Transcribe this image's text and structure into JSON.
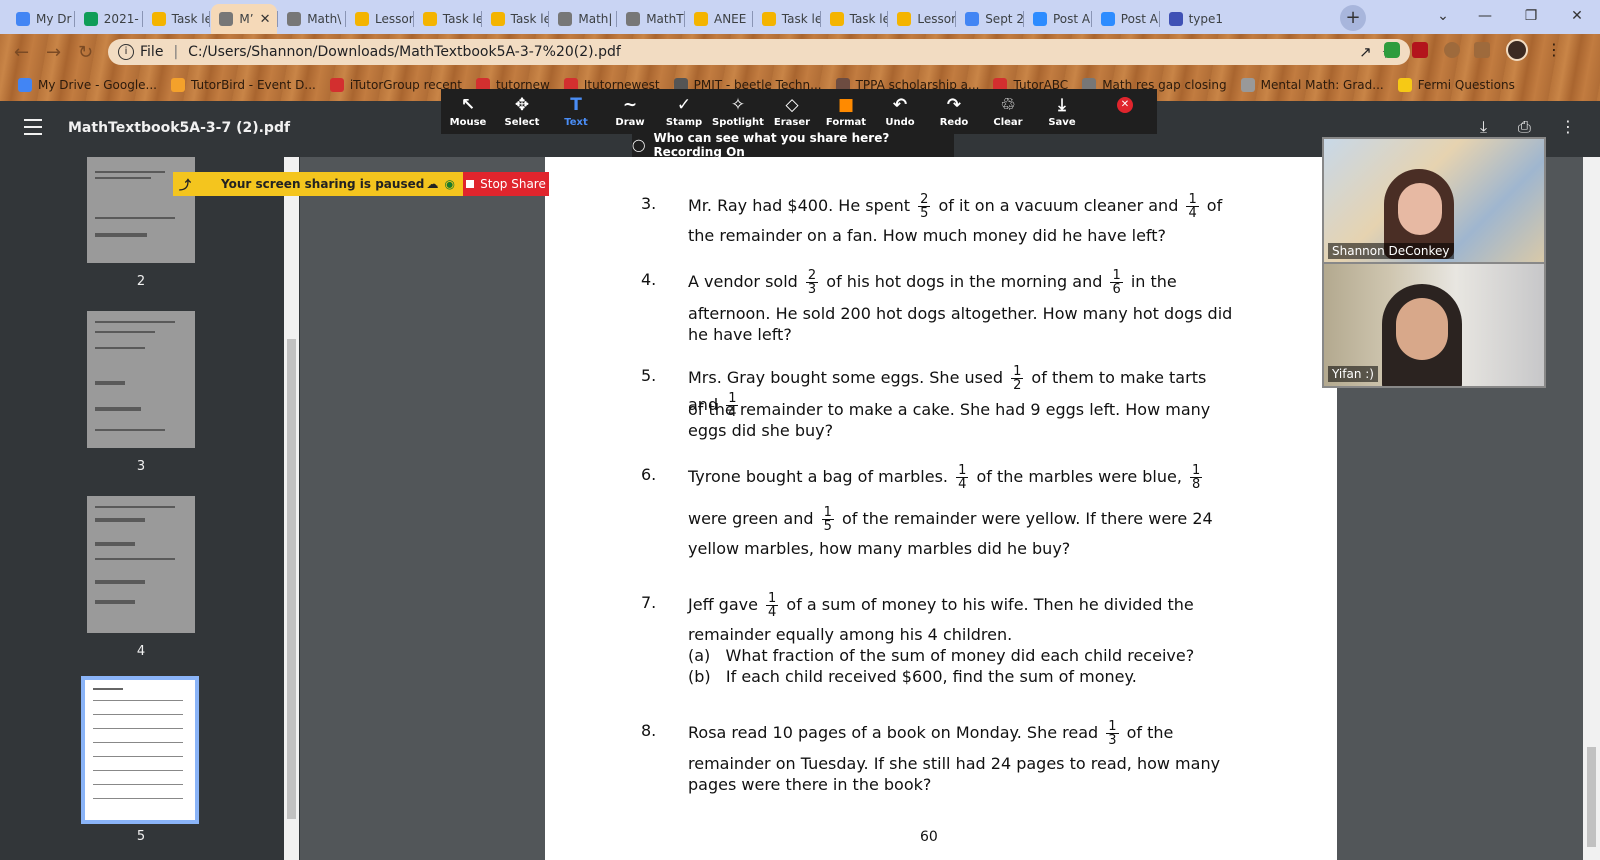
{
  "tabs": [
    {
      "label": "My Dr",
      "color": "#4285f4"
    },
    {
      "label": "2021-",
      "color": "#0f9d58"
    },
    {
      "label": "Task le",
      "color": "#f4b400"
    },
    {
      "label": "M’",
      "color": "#777777"
    },
    {
      "label": "Math\\",
      "color": "#777777"
    },
    {
      "label": "Lessor",
      "color": "#f4b400"
    },
    {
      "label": "Task le",
      "color": "#f4b400"
    },
    {
      "label": "Task le",
      "color": "#f4b400"
    },
    {
      "label": "Math|",
      "color": "#777777"
    },
    {
      "label": "MathT",
      "color": "#777777"
    },
    {
      "label": "ANEE",
      "color": "#f4b400"
    },
    {
      "label": "Task le",
      "color": "#f4b400"
    },
    {
      "label": "Task le",
      "color": "#f4b400"
    },
    {
      "label": "Lessor",
      "color": "#f4b400"
    },
    {
      "label": "Sept 2",
      "color": "#4285f4"
    },
    {
      "label": "Post A",
      "color": "#2d8cff"
    },
    {
      "label": "Post A",
      "color": "#2d8cff"
    },
    {
      "label": "type1",
      "color": "#3f51b5"
    }
  ],
  "address": {
    "prefix": "File",
    "url": "C:/Users/Shannon/Downloads/MathTextbook5A-3-7%20(2).pdf"
  },
  "bookmarks": [
    {
      "label": "My Drive - Google...",
      "color": "#4285f4"
    },
    {
      "label": "TutorBird - Event D...",
      "color": "#f4a12b"
    },
    {
      "label": "iTutorGroup recent",
      "color": "#d32f2f"
    },
    {
      "label": "tutornew",
      "color": "#d32f2f"
    },
    {
      "label": "Itutornewest",
      "color": "#d32f2f"
    },
    {
      "label": "PMIT - beetle Techn...",
      "color": "#555555"
    },
    {
      "label": "TPPA scholarship a...",
      "color": "#6d4c41"
    },
    {
      "label": "TutorABC",
      "color": "#d32f2f"
    },
    {
      "label": "Math res gap closing",
      "color": "#777777"
    },
    {
      "label": "Mental Math: Grad...",
      "color": "#999999"
    },
    {
      "label": "Fermi Questions",
      "color": "#f6c915"
    }
  ],
  "pdf": {
    "title": "MathTextbook5A-3-7 (2).pdf"
  },
  "annotation_tools": [
    {
      "icon": "↖",
      "label": "Mouse"
    },
    {
      "icon": "✥",
      "label": "Select"
    },
    {
      "icon": "T",
      "label": "Text"
    },
    {
      "icon": "∼",
      "label": "Draw"
    },
    {
      "icon": "✓",
      "label": "Stamp"
    },
    {
      "icon": "✧",
      "label": "Spotlight"
    },
    {
      "icon": "◇",
      "label": "Eraser"
    },
    {
      "icon": "■",
      "label": "Format"
    },
    {
      "icon": "↶",
      "label": "Undo"
    },
    {
      "icon": "↷",
      "label": "Redo"
    },
    {
      "icon": "♲",
      "label": "Clear"
    },
    {
      "icon": "⤓",
      "label": "Save"
    }
  ],
  "recording_text": "Who can see what you share here? Recording On",
  "share": {
    "paused_text": "Your screen sharing is paused",
    "stop_label": "Stop Share"
  },
  "thumbnails": [
    "2",
    "3",
    "4",
    "5"
  ],
  "questions": [
    {
      "num": "3.",
      "lines": [
        [
          "Mr. Ray had $400. He spent ",
          {
            "n": "2",
            "d": "5"
          },
          " of it on a vacuum cleaner and ",
          {
            "n": "1",
            "d": "4"
          },
          " of"
        ],
        [
          "the remainder on a fan. How much money did he have left?"
        ]
      ]
    },
    {
      "num": "4.",
      "lines": [
        [
          "A vendor sold ",
          {
            "n": "2",
            "d": "3"
          },
          " of his hot dogs in the morning and ",
          {
            "n": "1",
            "d": "6"
          },
          " in the"
        ],
        [
          "afternoon. He sold 200 hot dogs altogether. How many hot dogs did"
        ],
        [
          "he have left?"
        ]
      ]
    },
    {
      "num": "5.",
      "lines": [
        [
          "Mrs. Gray bought some eggs. She used ",
          {
            "n": "1",
            "d": "2"
          },
          " of them to make tarts and ",
          {
            "n": "1",
            "d": "4"
          }
        ],
        [
          "of the remainder to make a cake. She had 9 eggs left. How many"
        ],
        [
          "eggs did she buy?"
        ]
      ]
    },
    {
      "num": "6.",
      "lines": [
        [
          "Tyrone bought a bag of marbles. ",
          {
            "n": "1",
            "d": "4"
          },
          " of the marbles were blue, ",
          {
            "n": "1",
            "d": "8"
          }
        ],
        [
          "were green and ",
          {
            "n": "1",
            "d": "5"
          },
          " of the remainder were yellow. If there were 24"
        ],
        [
          "yellow marbles, how many marbles did he buy?"
        ]
      ]
    },
    {
      "num": "7.",
      "lines": [
        [
          "Jeff gave ",
          {
            "n": "1",
            "d": "4"
          },
          " of a sum of money to his wife. Then he divided the"
        ],
        [
          "remainder equally among his 4 children."
        ],
        [
          "(a)   What fraction of the sum of money did each child receive?"
        ],
        [
          "(b)   If each child received $600, find the sum of money."
        ]
      ]
    },
    {
      "num": "8.",
      "lines": [
        [
          "Rosa read 10 pages of a book on Monday. She read ",
          {
            "n": "1",
            "d": "3"
          },
          " of the"
        ],
        [
          "remainder on Tuesday. If she still had 24 pages to read, how many"
        ],
        [
          "pages were there in the book?"
        ]
      ]
    }
  ],
  "page_number": "60",
  "participants": [
    {
      "name": "Shannon DeConkey"
    },
    {
      "name": "Yifan :)"
    }
  ]
}
